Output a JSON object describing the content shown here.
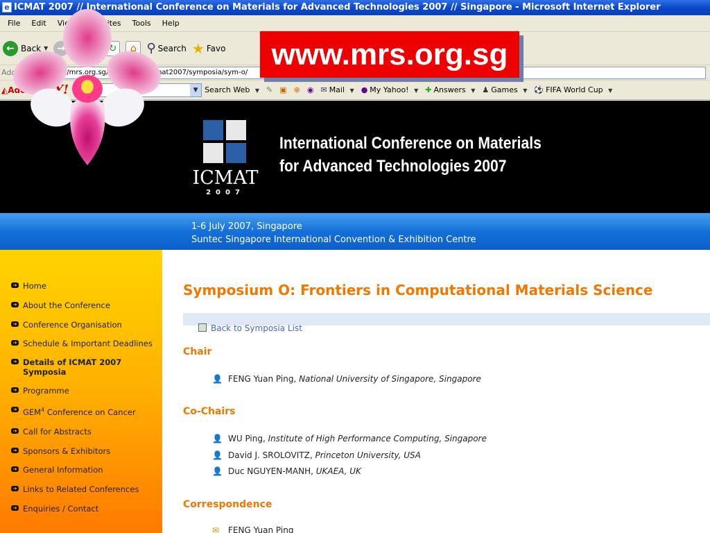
{
  "window": {
    "title": "ICMAT 2007 // International Conference on Materials for Advanced Technologies 2007 // Singapore - Microsoft Internet Explorer"
  },
  "menu": [
    "File",
    "Edit",
    "View",
    "Favorites",
    "Tools",
    "Help"
  ],
  "toolbar": {
    "back_label": "Back",
    "search_label": "Search",
    "favorites_label": "Favo"
  },
  "address": {
    "label": "Address",
    "url": "http://mrs.org.sg/conference/icmat2007/symposia/sym-o/"
  },
  "links_bar": {
    "adobe": "Adobe",
    "yahoo": "Y!",
    "search_web": "Search Web",
    "mail": "Mail",
    "my_yahoo": "My Yahoo!",
    "answers": "Answers",
    "games": "Games",
    "fifa": "FIFA World Cup"
  },
  "overlay_url": "www.mrs.org.sg",
  "banner": {
    "logo_word": "ICMAT",
    "logo_year": "2007",
    "title_line1": "International Conference on Materials",
    "title_line2": "for Advanced Technologies 2007",
    "date_line": "1-6 July 2007, Singapore",
    "venue_line": "Suntec Singapore International Convention & Exhibition Centre"
  },
  "sidebar": {
    "items": [
      {
        "label": "Home"
      },
      {
        "label": "About the Conference"
      },
      {
        "label": "Conference Organisation"
      },
      {
        "label": "Schedule & Important Deadlines"
      },
      {
        "label": "Details of ICMAT 2007 Symposia"
      },
      {
        "label": "Programme"
      },
      {
        "label": "GEM",
        "sup": "4",
        "rest": " Conference on Cancer"
      },
      {
        "label": "Call for Abstracts"
      },
      {
        "label": "Sponsors & Exhibitors"
      },
      {
        "label": "General Information"
      },
      {
        "label": "Links to Related Conferences"
      },
      {
        "label": "Enquiries / Contact"
      }
    ]
  },
  "content": {
    "symposium_title": "Symposium O: Frontiers in Computational Materials Science",
    "back_link": "Back to Symposia List",
    "chair_heading": "Chair",
    "chair": {
      "name": "FENG Yuan Ping, ",
      "affiliation": "National University of Singapore, Singapore"
    },
    "cochairs_heading": "Co-Chairs",
    "cochairs": [
      {
        "name": "WU Ping, ",
        "affiliation": "Institute of High Performance Computing, Singapore"
      },
      {
        "name": "David J. SROLOVITZ, ",
        "affiliation": "Princeton University, USA"
      },
      {
        "name": "Duc NGUYEN-MANH, ",
        "affiliation": "UKAEA, UK"
      }
    ],
    "correspondence_heading": "Correspondence",
    "correspondence_name": "FENG Yuan Ping"
  }
}
